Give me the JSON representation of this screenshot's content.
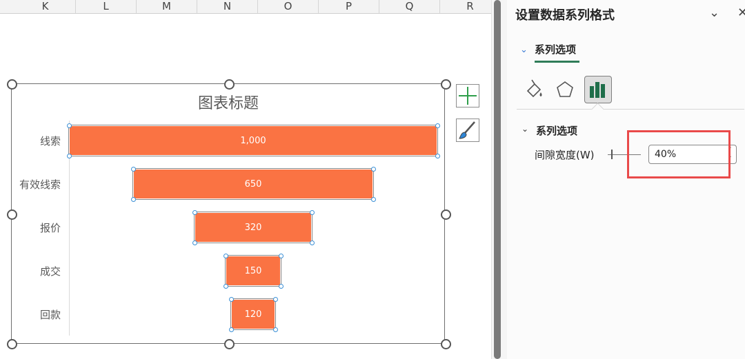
{
  "sheet": {
    "columns": [
      "K",
      "L",
      "M",
      "N",
      "O",
      "P",
      "Q",
      "R"
    ]
  },
  "chart": {
    "title": "图表标题",
    "bar_color": "#fa7343",
    "categories": [
      "线索",
      "有效线索",
      "报价",
      "成交",
      "回款"
    ],
    "value_labels": [
      "1,000",
      "650",
      "320",
      "150",
      "120"
    ],
    "values": [
      1000,
      650,
      320,
      150,
      120
    ],
    "add_element_icon": "plus-icon",
    "style_icon": "brush-icon"
  },
  "chart_data": {
    "type": "bar",
    "title": "图表标题",
    "categories": [
      "线索",
      "有效线索",
      "报价",
      "成交",
      "回款"
    ],
    "values": [
      1000,
      650,
      320,
      150,
      120
    ],
    "orientation": "horizontal-funnel",
    "grid": false
  },
  "pane": {
    "title": "设置数据系列格式",
    "collapse_icon": "chevron-down-icon",
    "close_icon": "close-icon",
    "tab_label": "系列选项",
    "icons": [
      "fill-line-icon",
      "effects-pentagon-icon",
      "series-options-bar-icon"
    ],
    "section_label": "系列选项",
    "gap_width_label": "间隙宽度(W)",
    "gap_width_value": "40%",
    "highlight_color": "#e94a4a",
    "accent_color": "#2f7c58"
  }
}
